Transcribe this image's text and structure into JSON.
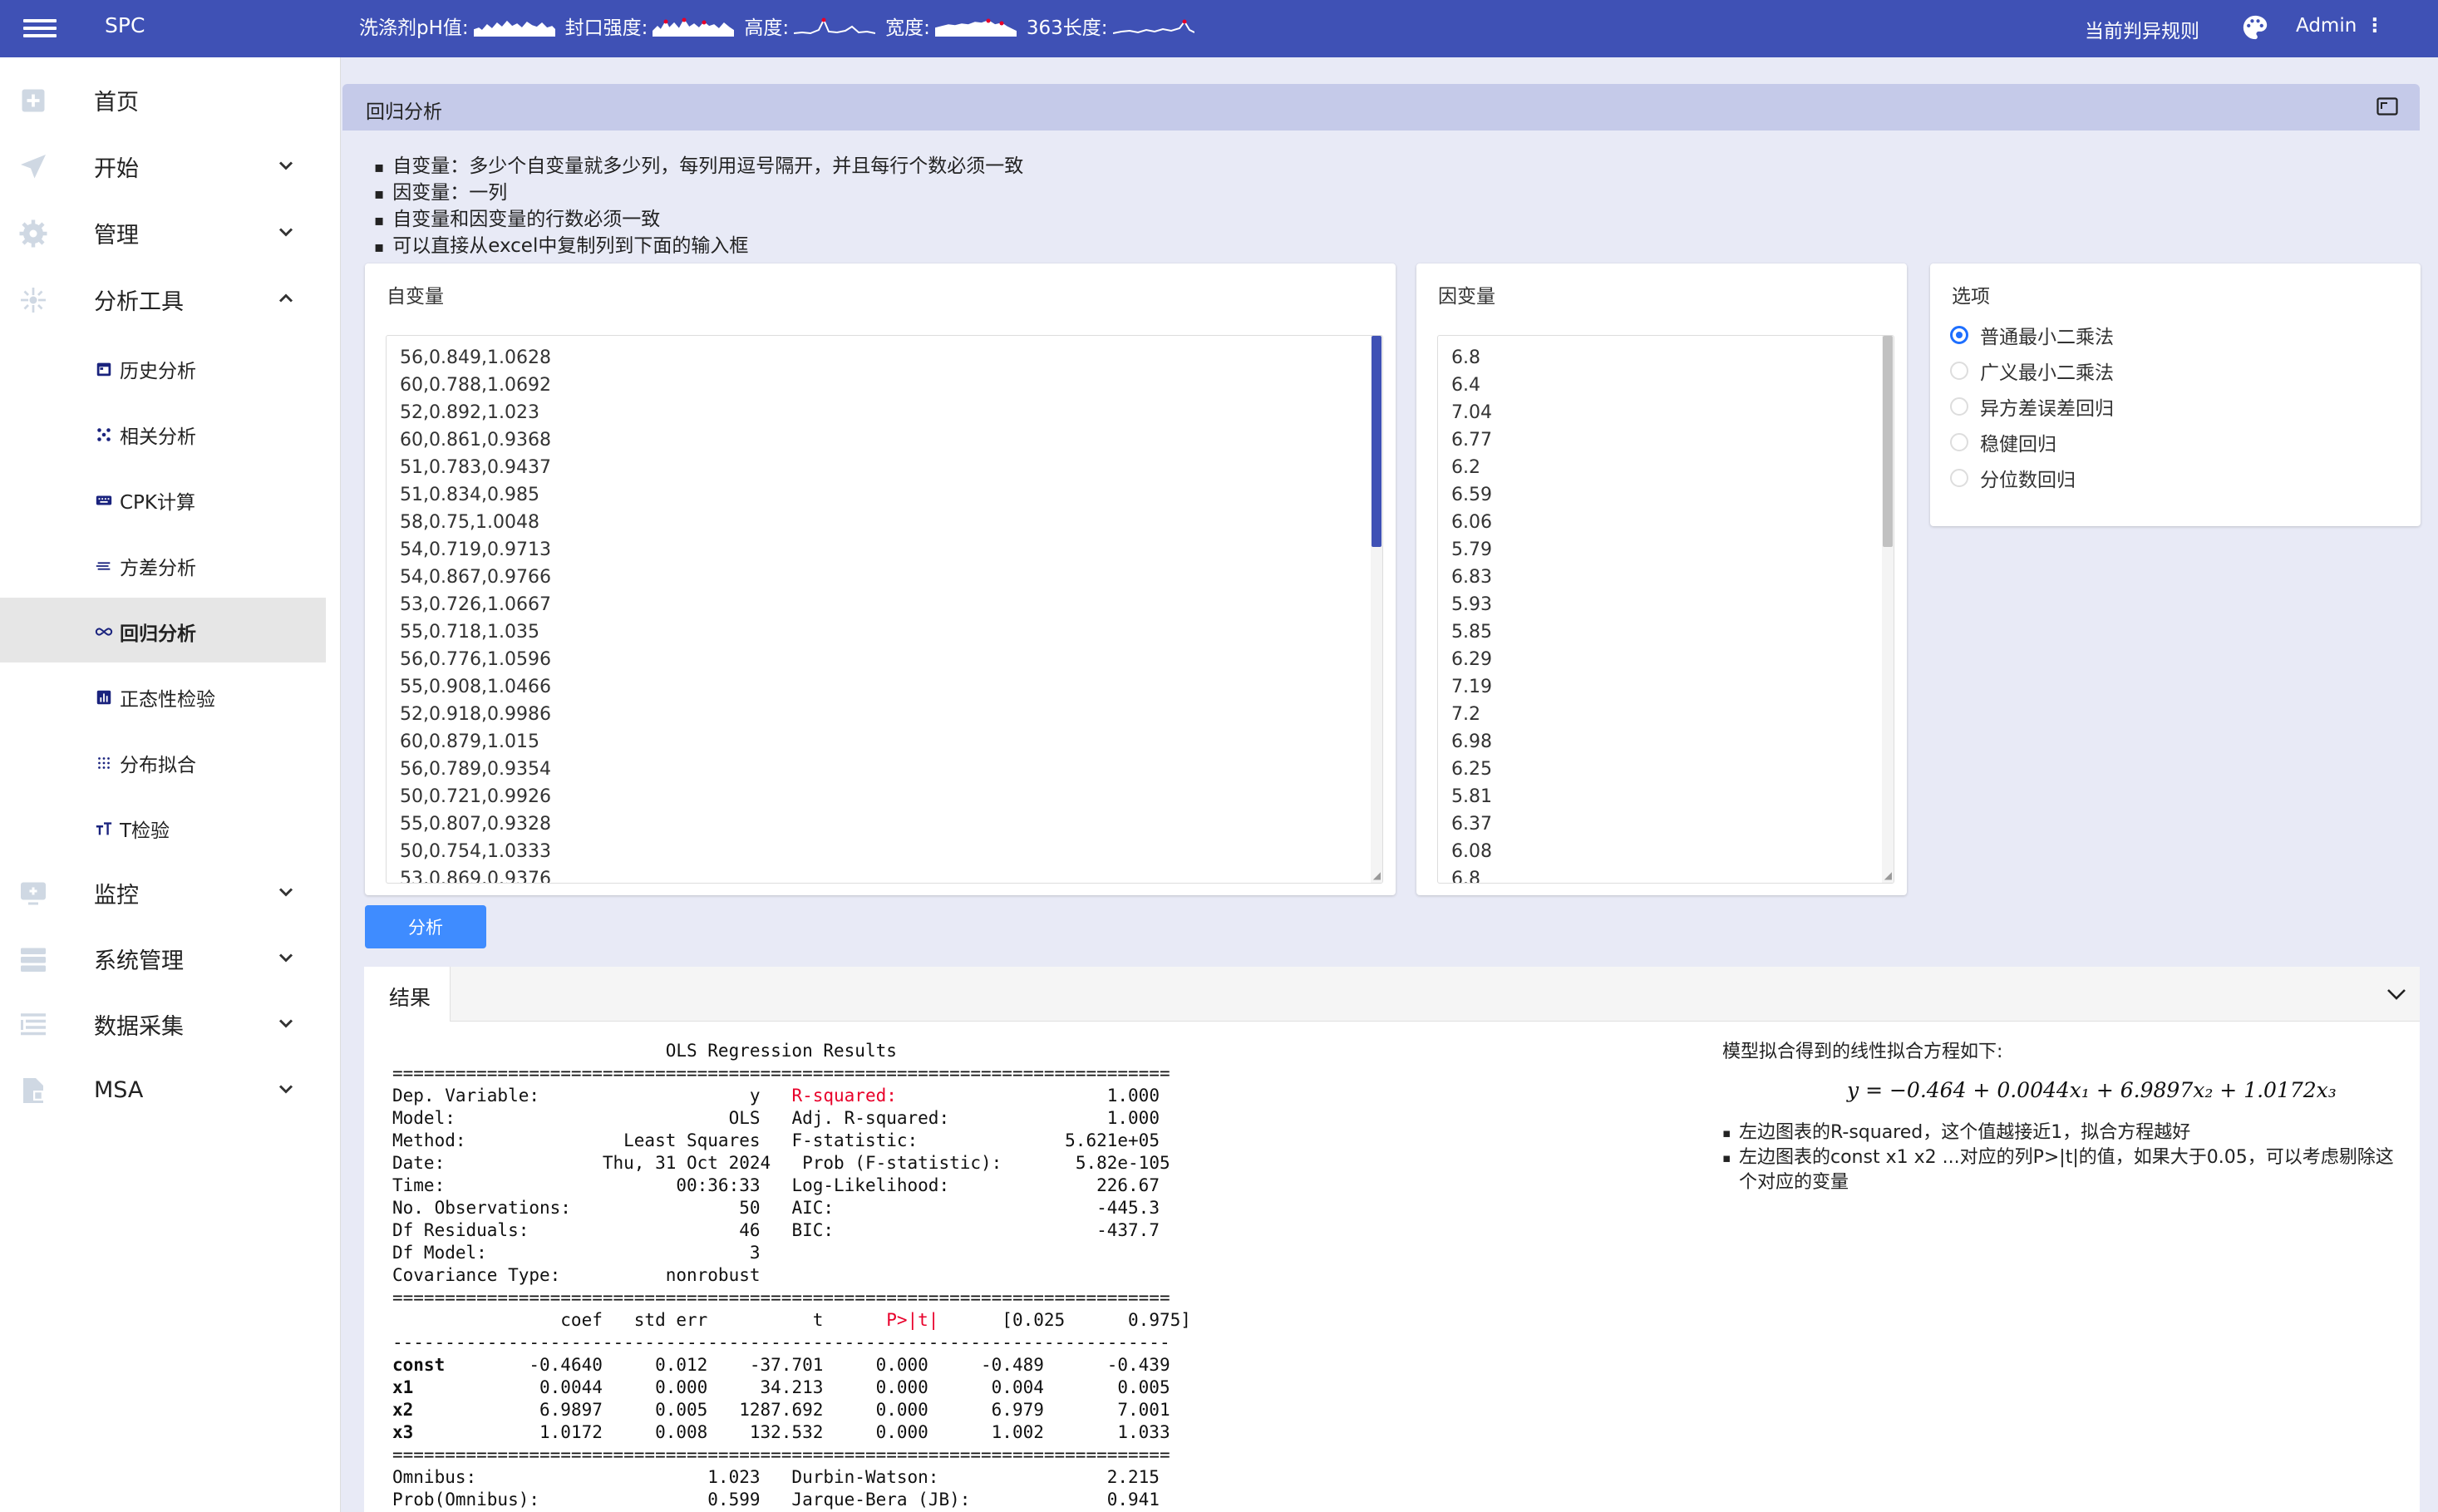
{
  "app": {
    "brand": "SPC",
    "rule_link": "当前判异规则",
    "user": "Admin"
  },
  "metrics": [
    {
      "label": "洗涤剂pH值:"
    },
    {
      "label": "封口强度:"
    },
    {
      "label": "高度:"
    },
    {
      "label": "宽度:"
    },
    {
      "label": "363长度:"
    }
  ],
  "sidebar": {
    "items": [
      {
        "label": "首页"
      },
      {
        "label": "开始"
      },
      {
        "label": "管理"
      },
      {
        "label": "分析工具"
      }
    ],
    "sub_items": [
      {
        "label": "历史分析"
      },
      {
        "label": "相关分析"
      },
      {
        "label": "CPK计算"
      },
      {
        "label": "方差分析"
      },
      {
        "label": "回归分析"
      },
      {
        "label": "正态性检验"
      },
      {
        "label": "分布拟合"
      },
      {
        "label": "T检验"
      }
    ],
    "bottom_items": [
      {
        "label": "监控"
      },
      {
        "label": "系统管理"
      },
      {
        "label": "数据采集"
      },
      {
        "label": "MSA"
      }
    ]
  },
  "panel": {
    "title": "回归分析"
  },
  "tips": [
    "自变量：多少个自变量就多少列，每列用逗号隔开，并且每行个数必须一致",
    "因变量：一列",
    "自变量和因变量的行数必须一致",
    "可以直接从excel中复制列到下面的输入框"
  ],
  "independent": {
    "title": "自变量",
    "lines": [
      "56,0.849,1.0628",
      "60,0.788,1.0692",
      "52,0.892,1.023",
      "60,0.861,0.9368",
      "51,0.783,0.9437",
      "51,0.834,0.985",
      "58,0.75,1.0048",
      "54,0.719,0.9713",
      "54,0.867,0.9766",
      "53,0.726,1.0667",
      "55,0.718,1.035",
      "56,0.776,1.0596",
      "55,0.908,1.0466",
      "52,0.918,0.9986",
      "60,0.879,1.015",
      "56,0.789,0.9354",
      "50,0.721,0.9926",
      "55,0.807,0.9328",
      "50,0.754,1.0333",
      "53,0.869,0.9376"
    ]
  },
  "dependent": {
    "title": "因变量",
    "lines": [
      "6.8",
      "6.4",
      "7.04",
      "6.77",
      "6.2",
      "6.59",
      "6.06",
      "5.79",
      "6.83",
      "5.93",
      "5.85",
      "6.29",
      "7.19",
      "7.2",
      "6.98",
      "6.25",
      "5.81",
      "6.37",
      "6.08",
      "6.8"
    ]
  },
  "options": {
    "title": "选项",
    "items": [
      "普通最小二乘法",
      "广义最小二乘法",
      "异方差误差回归",
      "稳健回归",
      "分位数回归"
    ],
    "selected": 0
  },
  "analyze_button": "分析",
  "result": {
    "tab": "结果",
    "ols": {
      "title": "OLS Regression Results",
      "left": [
        [
          "Dep. Variable:",
          "y"
        ],
        [
          "Model:",
          "OLS"
        ],
        [
          "Method:",
          "Least Squares"
        ],
        [
          "Date:",
          "Thu, 31 Oct 2024"
        ],
        [
          "Time:",
          "00:36:33"
        ],
        [
          "No. Observations:",
          "50"
        ],
        [
          "Df Residuals:",
          "46"
        ],
        [
          "Df Model:",
          "3"
        ],
        [
          "Covariance Type:",
          "nonrobust"
        ]
      ],
      "right": [
        [
          "R-squared:",
          "1.000"
        ],
        [
          "Adj. R-squared:",
          "1.000"
        ],
        [
          "F-statistic:",
          "5.621e+05"
        ],
        [
          "Prob (F-statistic):",
          "5.82e-105"
        ],
        [
          "Log-Likelihood:",
          "226.67"
        ],
        [
          "AIC:",
          "-445.3"
        ],
        [
          "BIC:",
          "-437.7"
        ]
      ],
      "coef_header": [
        "coef",
        "std err",
        "t",
        "P>|t|",
        "[0.025",
        "0.975]"
      ],
      "coef_rows": [
        [
          "const",
          "-0.4640",
          "0.012",
          "-37.701",
          "0.000",
          "-0.489",
          "-0.439"
        ],
        [
          "x1",
          "0.0044",
          "0.000",
          "34.213",
          "0.000",
          "0.004",
          "0.005"
        ],
        [
          "x2",
          "6.9897",
          "0.005",
          "1287.692",
          "0.000",
          "6.979",
          "7.001"
        ],
        [
          "x3",
          "1.0172",
          "0.008",
          "132.532",
          "0.000",
          "1.002",
          "1.033"
        ]
      ],
      "diag": [
        [
          "Omnibus:",
          "1.023",
          "Durbin-Watson:",
          "2.215"
        ],
        [
          "Prob(Omnibus):",
          "0.599",
          "Jarque-Bera (JB):",
          "0.941"
        ]
      ]
    },
    "formula_heading": "模型拟合得到的线性拟合方程如下:",
    "formula": "y = −0.464 + 0.0044x₁ + 6.9897x₂ + 1.0172x₃",
    "notes": [
      "左边图表的R-squared，这个值越接近1，拟合方程越好",
      "左边图表的const x1 x2 ...对应的列P>|t|的值，如果大于0.05，可以考虑剔除这个对应的变量"
    ]
  },
  "colors": {
    "primary": "#3f51b5",
    "accent_blue": "#3f8cff",
    "highlight_red": "#e8002a",
    "main_bg": "#e8eaf6",
    "panel_header": "#c5cae9"
  }
}
